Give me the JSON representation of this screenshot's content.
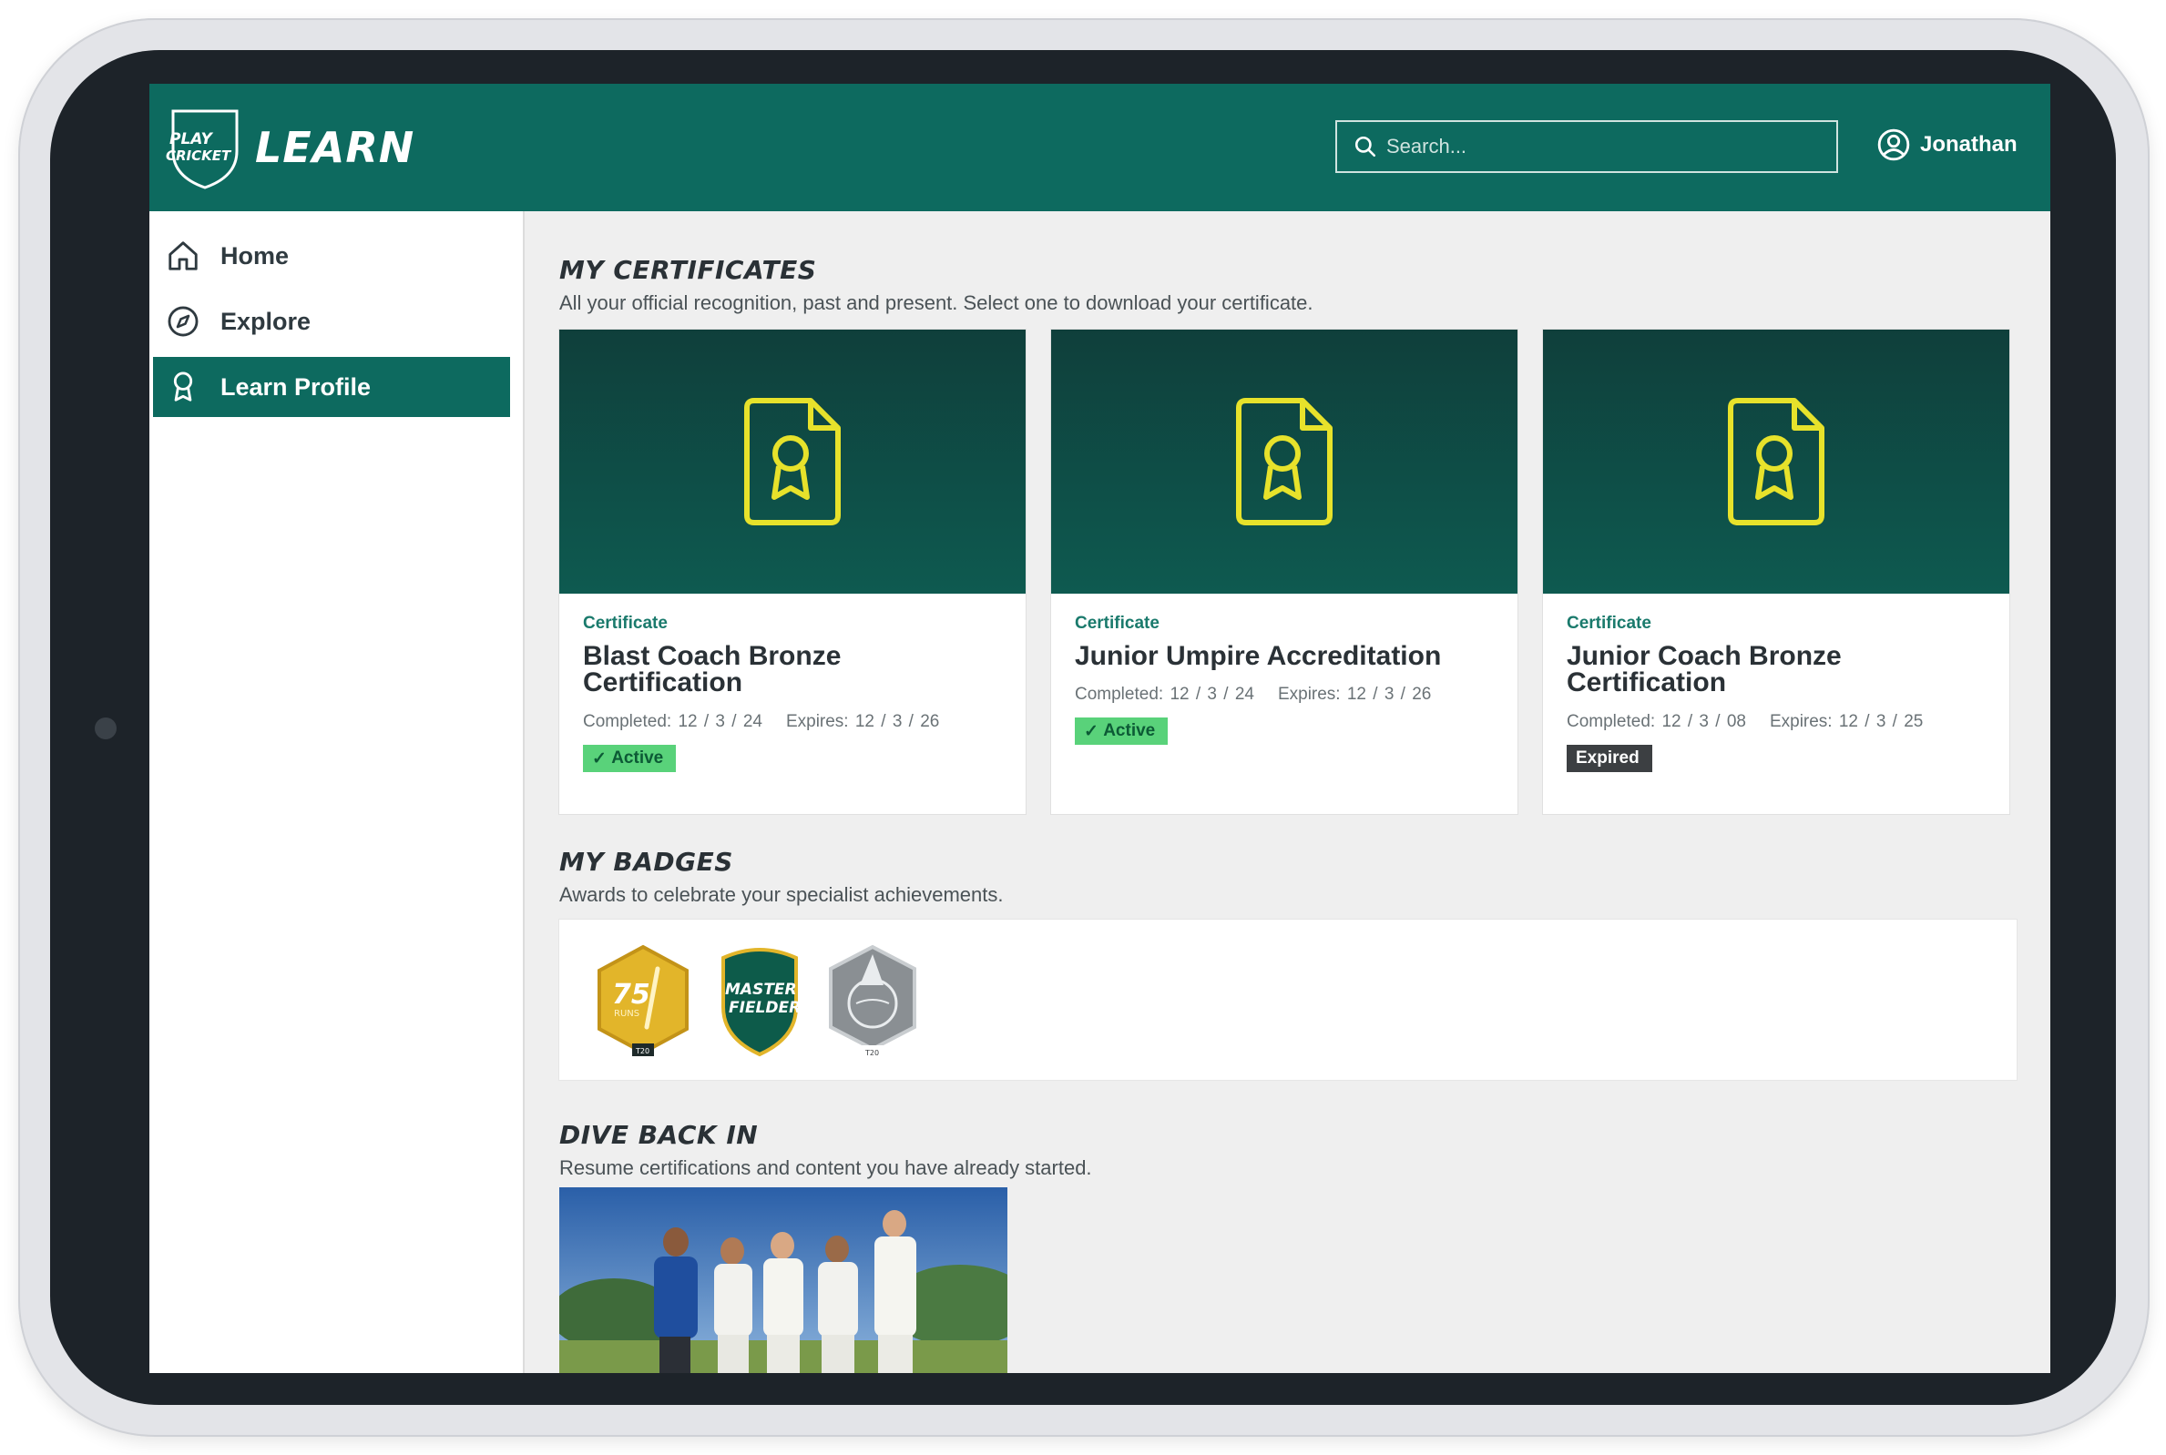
{
  "header": {
    "logo_small_line1": "PLAY",
    "logo_small_line2": "CRICKET",
    "logo_word": "LEARN",
    "search_placeholder": "Search...",
    "user_name": "Jonathan"
  },
  "sidebar": {
    "items": [
      {
        "label": "Home",
        "icon": "home-icon",
        "active": false
      },
      {
        "label": "Explore",
        "icon": "compass-icon",
        "active": false
      },
      {
        "label": "Learn Profile",
        "icon": "award-icon",
        "active": true
      }
    ]
  },
  "certificates": {
    "title": "MY CERTIFICATES",
    "subtitle": "All your official recognition, past and present. Select one to download your certificate.",
    "items": [
      {
        "kicker": "Certificate",
        "title": "Blast Coach Bronze Certification",
        "completed": "Completed: 12 / 3 / 24",
        "expires": "Expires: 12 / 3 / 26",
        "status": "Active"
      },
      {
        "kicker": "Certificate",
        "title": "Junior Umpire Accreditation",
        "completed": "Completed: 12 / 3 / 24",
        "expires": "Expires: 12 / 3 / 26",
        "status": "Active"
      },
      {
        "kicker": "Certificate",
        "title": "Junior Coach Bronze Certification",
        "completed": "Completed: 12 / 3 / 08",
        "expires": "Expires: 12 / 3 / 25",
        "status": "Expired"
      }
    ]
  },
  "badges": {
    "title": "MY BADGES",
    "subtitle": "Awards to celebrate your specialist achievements.",
    "items": [
      {
        "name": "75 runs badge",
        "big": "75",
        "small": "RUNS",
        "tag": "T20",
        "color": "#e2b52a"
      },
      {
        "name": "master fielder badge",
        "line1": "MASTER",
        "line2": "FIELDER",
        "color": "#0d5b4a"
      },
      {
        "name": "wizard ball badge",
        "tag": "T20",
        "color": "#8a8f93"
      }
    ]
  },
  "resume": {
    "title": "DIVE BACK IN",
    "subtitle": "Resume certifications and content you have already started."
  },
  "colors": {
    "brand": "#0d6a5f",
    "accent_yellow": "#e7e22b",
    "active_green": "#59d27a",
    "expired_dark": "#3c3f42"
  }
}
